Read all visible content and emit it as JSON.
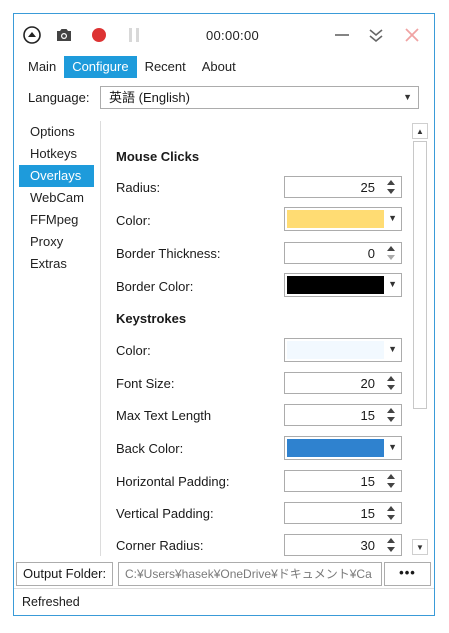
{
  "titlebar": {
    "timer": "00:00:00",
    "icons": [
      "menu-up-icon",
      "camera-icon",
      "record-icon",
      "pause-icon",
      "minimize-icon",
      "collapse-icon",
      "close-icon"
    ],
    "record_color": "#e03131",
    "close_color": "#f0a0a0"
  },
  "tabs": [
    "Main",
    "Configure",
    "Recent",
    "About"
  ],
  "active_tab": "Configure",
  "language": {
    "label": "Language:",
    "value": "英語 (English)"
  },
  "sidebar": [
    "Options",
    "Hotkeys",
    "Overlays",
    "WebCam",
    "FFMpeg",
    "Proxy",
    "Extras"
  ],
  "active_sidebar": "Overlays",
  "mouse_clicks": {
    "title": "Mouse Clicks",
    "radius_label": "Radius:",
    "radius": "25",
    "color_label": "Color:",
    "color": "#ffdc73",
    "border_thickness_label": "Border Thickness:",
    "border_thickness": "0",
    "border_color_label": "Border Color:",
    "border_color": "#000000"
  },
  "keystrokes": {
    "title": "Keystrokes",
    "color_label": "Color:",
    "color": "#f2f9ff",
    "font_size_label": "Font Size:",
    "font_size": "20",
    "max_text_length_label": "Max Text Length",
    "max_text_length": "15",
    "back_color_label": "Back Color:",
    "back_color": "#2f82cf",
    "h_padding_label": "Horizontal Padding:",
    "h_padding": "15",
    "v_padding_label": "Vertical Padding:",
    "v_padding": "15",
    "corner_radius_label": "Corner Radius:",
    "corner_radius": "30"
  },
  "output": {
    "label": "Output Folder:",
    "path": "C:¥Users¥hasek¥OneDrive¥ドキュメント¥Ca",
    "browse": "•••"
  },
  "status": "Refreshed",
  "accent": "#1e9bdb"
}
